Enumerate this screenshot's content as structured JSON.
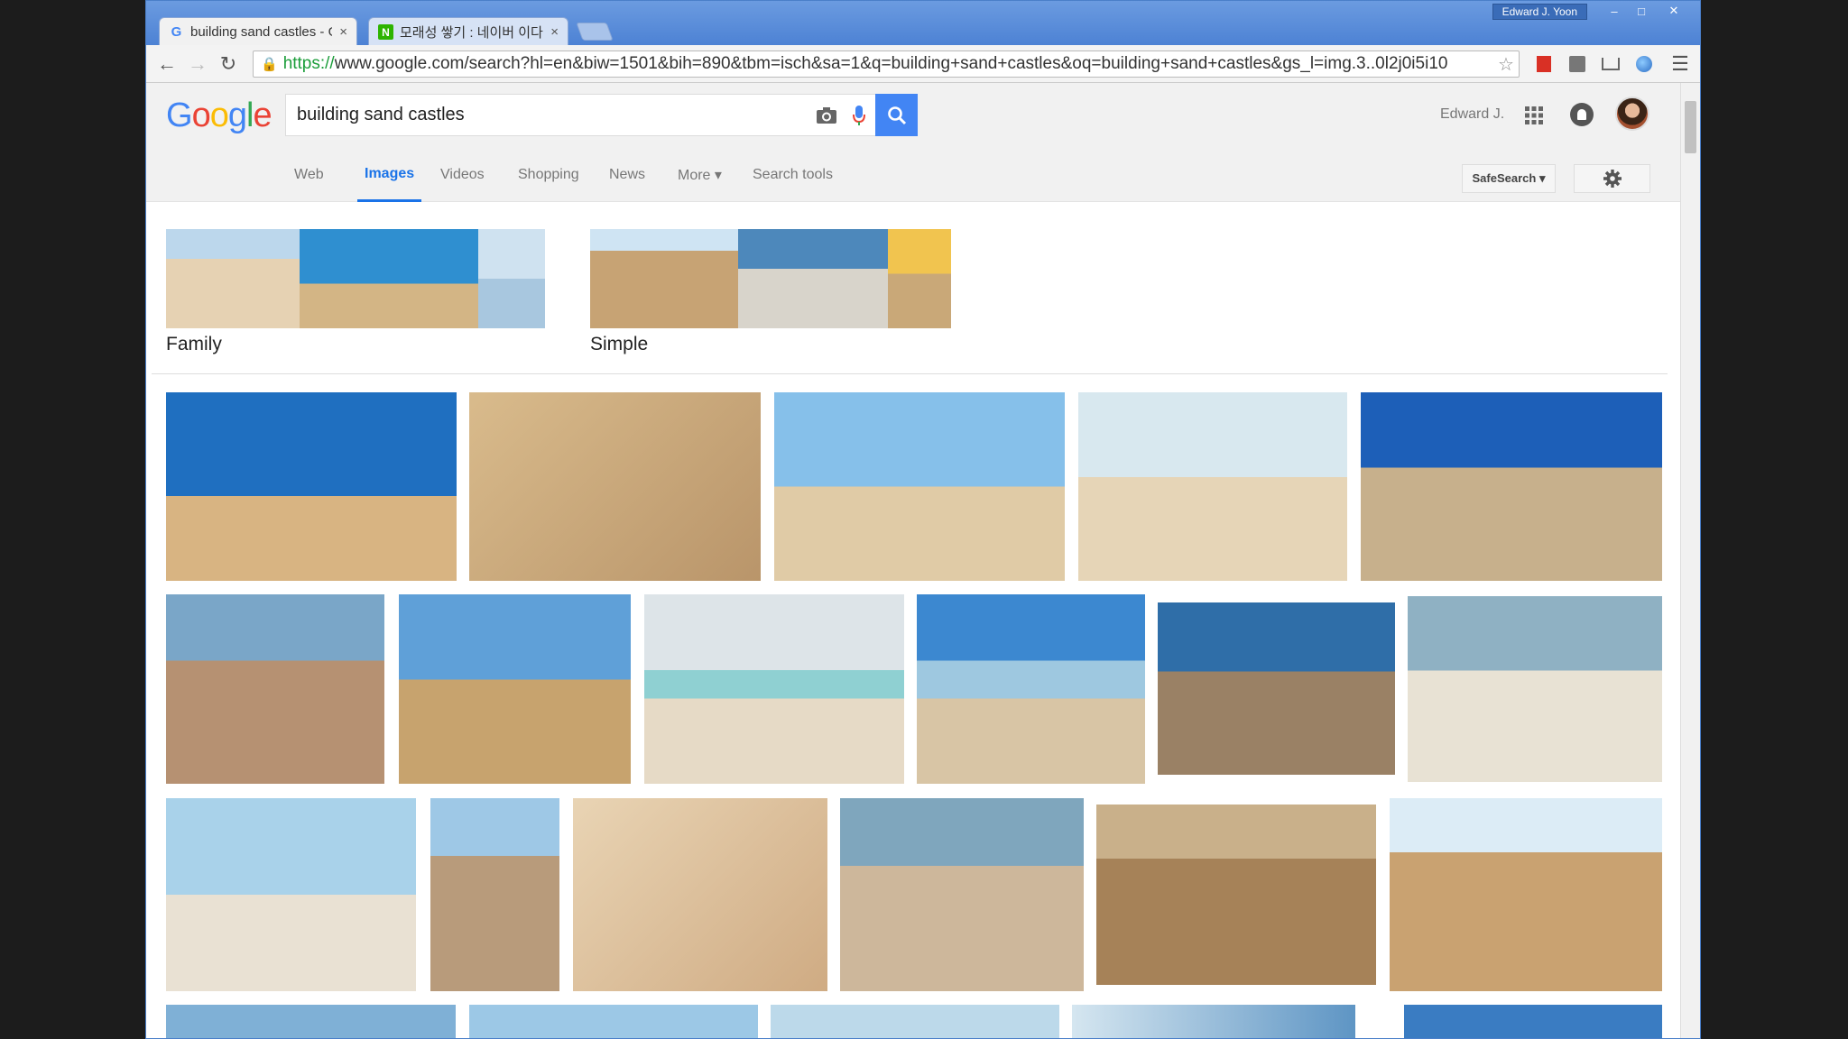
{
  "browser": {
    "tabs": [
      {
        "label": "building sand castles - G",
        "favicon": "google-g-icon",
        "active": true
      },
      {
        "label": "모래성 쌓기 : 네이버 이다",
        "favicon": "naver-n-icon",
        "active": false
      }
    ],
    "user_badge": "Edward J. Yoon",
    "window_controls": [
      "minimize-icon",
      "maximize-icon",
      "close-icon"
    ],
    "url_scheme": "https://",
    "url_rest": "www.google.com/search?hl=en&biw=1501&bih=890&tbm=isch&sa=1&q=building+sand+castles&oq=building+sand+castles&gs_l=img.3..0l2j0i5i10"
  },
  "google": {
    "logo": "Google",
    "query": "building sand castles",
    "account_name": "Edward J.",
    "nav": [
      {
        "label": "Web",
        "active": false
      },
      {
        "label": "Images",
        "active": true
      },
      {
        "label": "Videos",
        "active": false
      },
      {
        "label": "Shopping",
        "active": false
      },
      {
        "label": "News",
        "active": false
      },
      {
        "label": "More ▾",
        "active": false
      },
      {
        "label": "Search tools",
        "active": false
      }
    ],
    "safesearch_label": "SafeSearch ▾",
    "related": [
      {
        "label": "Family"
      },
      {
        "label": "Simple"
      }
    ],
    "results_count_visible": 22
  },
  "colors": {
    "accent": "#4285f4",
    "sky": "#3c7fd0",
    "sand": "#d8b98a",
    "titlebar": "#5a8fdb"
  }
}
